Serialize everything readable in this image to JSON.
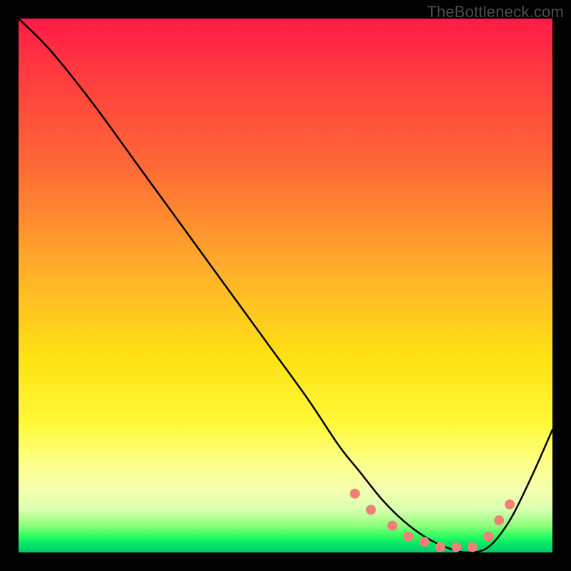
{
  "watermark": "TheBottleneck.com",
  "chart_data": {
    "type": "line",
    "title": "",
    "xlabel": "",
    "ylabel": "",
    "xlim": [
      0,
      100
    ],
    "ylim": [
      0,
      100
    ],
    "grid": false,
    "series": [
      {
        "name": "bottleneck-curve",
        "color": "#000000",
        "x": [
          0,
          6,
          14,
          22,
          30,
          38,
          46,
          54,
          60,
          64,
          68,
          72,
          76,
          80,
          84,
          88,
          92,
          96,
          100
        ],
        "values": [
          100,
          94,
          84,
          73,
          62,
          51,
          40,
          29,
          20,
          15,
          10,
          6,
          3,
          1,
          0,
          1,
          6,
          14,
          23
        ]
      }
    ],
    "markers": {
      "name": "highlight-dots",
      "color": "#f08075",
      "radius_px": 7,
      "x": [
        63,
        66,
        70,
        73,
        76,
        79,
        82,
        85,
        88,
        90,
        92
      ],
      "values": [
        11,
        8,
        5,
        3,
        2,
        1,
        1,
        1,
        3,
        6,
        9
      ]
    },
    "background_gradient": {
      "type": "linear-vertical",
      "stops": [
        {
          "pos": 0.0,
          "color": "#ff1a46"
        },
        {
          "pos": 0.28,
          "color": "#ff6a36"
        },
        {
          "pos": 0.64,
          "color": "#ffe313"
        },
        {
          "pos": 0.88,
          "color": "#f6ffae"
        },
        {
          "pos": 0.97,
          "color": "#2bff62"
        },
        {
          "pos": 1.0,
          "color": "#00c86a"
        }
      ]
    }
  }
}
